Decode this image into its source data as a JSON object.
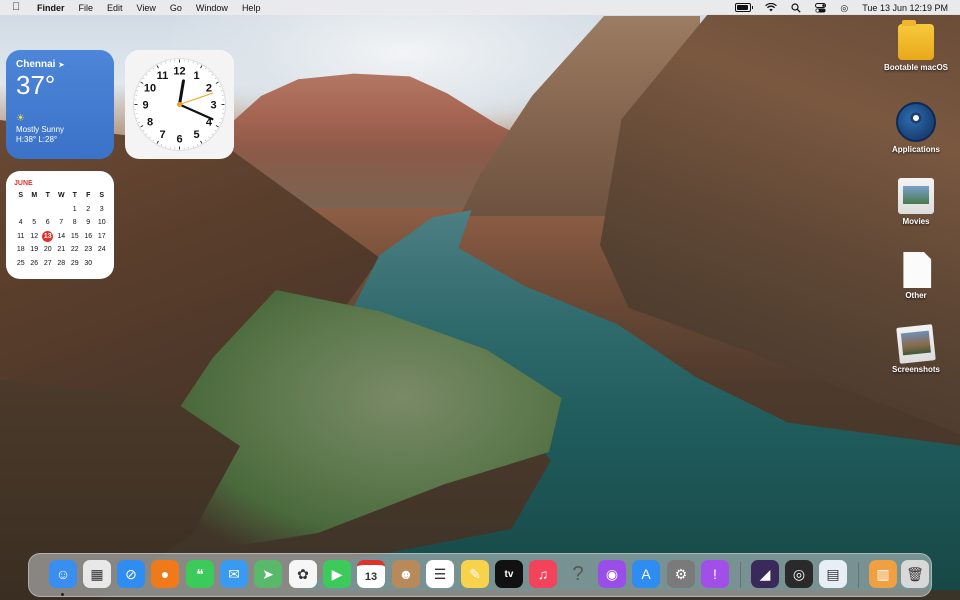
{
  "menubar": {
    "app": "Finder",
    "items": [
      "File",
      "Edit",
      "View",
      "Go",
      "Window",
      "Help"
    ],
    "datetime": "Tue 13 Jun  12:19 PM",
    "status_icons": [
      "battery-icon",
      "wifi-icon",
      "search-icon",
      "control-center-icon",
      "siri-icon"
    ]
  },
  "weather": {
    "city": "Chennai",
    "temp": "37°",
    "condition": "Mostly Sunny",
    "hilo": "H:38° L:28°",
    "icon": "sun-icon"
  },
  "clock": {
    "numbers": [
      "12",
      "1",
      "2",
      "3",
      "4",
      "5",
      "6",
      "7",
      "8",
      "9",
      "10",
      "11"
    ],
    "time": "12:19"
  },
  "calendar": {
    "month": "JUNE",
    "dow": [
      "S",
      "M",
      "T",
      "W",
      "T",
      "F",
      "S"
    ],
    "weeks": [
      [
        "",
        "",
        "",
        "",
        "1",
        "2",
        "3"
      ],
      [
        "4",
        "5",
        "6",
        "7",
        "8",
        "9",
        "10"
      ],
      [
        "11",
        "12",
        "13",
        "14",
        "15",
        "16",
        "17"
      ],
      [
        "18",
        "19",
        "20",
        "21",
        "22",
        "23",
        "24"
      ],
      [
        "25",
        "26",
        "27",
        "28",
        "29",
        "30",
        ""
      ]
    ],
    "today": "13"
  },
  "desktop_icons": [
    {
      "label": "Bootable macOS",
      "icon": "folder-icon"
    },
    {
      "label": "Applications",
      "icon": "steam-icon"
    },
    {
      "label": "Movies",
      "icon": "movies-icon"
    },
    {
      "label": "Other",
      "icon": "document-icon"
    },
    {
      "label": "Screenshots",
      "icon": "screenshots-icon"
    }
  ],
  "dock": {
    "apps": [
      {
        "name": "finder",
        "color": "#3a8ef0",
        "glyph": "☺"
      },
      {
        "name": "launchpad",
        "color": "#e8e8e8",
        "glyph": "▦"
      },
      {
        "name": "safari",
        "color": "#2f8cf0",
        "glyph": "⊘"
      },
      {
        "name": "firefox",
        "color": "#f07a1a",
        "glyph": "●"
      },
      {
        "name": "messages",
        "color": "#3ccb5a",
        "glyph": "❝"
      },
      {
        "name": "mail",
        "color": "#3a9af0",
        "glyph": "✉"
      },
      {
        "name": "maps",
        "color": "#5ab86a",
        "glyph": "➤"
      },
      {
        "name": "photos",
        "color": "#f6f6f6",
        "glyph": "✿"
      },
      {
        "name": "facetime",
        "color": "#3ccb5a",
        "glyph": "▶"
      },
      {
        "name": "calendar",
        "color": "#ffffff",
        "glyph": "13"
      },
      {
        "name": "contacts",
        "color": "#b8895a",
        "glyph": "☻"
      },
      {
        "name": "reminders",
        "color": "#ffffff",
        "glyph": "☰"
      },
      {
        "name": "notes",
        "color": "#f7d24a",
        "glyph": "✎"
      },
      {
        "name": "tv",
        "color": "#111111",
        "glyph": "tv"
      },
      {
        "name": "music",
        "color": "#f2435a",
        "glyph": "♫"
      },
      {
        "name": "help",
        "color": "transparent",
        "glyph": "?"
      },
      {
        "name": "podcasts",
        "color": "#9a4ee8",
        "glyph": "◉"
      },
      {
        "name": "app-store",
        "color": "#2f8cf0",
        "glyph": "A"
      },
      {
        "name": "system-settings",
        "color": "#7a7a7a",
        "glyph": "⚙"
      },
      {
        "name": "feedback",
        "color": "#a24ee8",
        "glyph": "!"
      },
      {
        "name": "pixelmator",
        "color": "#3a2a5a",
        "glyph": "◢"
      },
      {
        "name": "quicktime",
        "color": "#2a2a2a",
        "glyph": "◎"
      },
      {
        "name": "preview",
        "color": "#e8eef6",
        "glyph": "▤"
      },
      {
        "name": "downloads-stack",
        "color": "#f0a040",
        "glyph": "▥"
      },
      {
        "name": "trash",
        "color": "#d8d8d8",
        "glyph": "🗑"
      }
    ]
  }
}
